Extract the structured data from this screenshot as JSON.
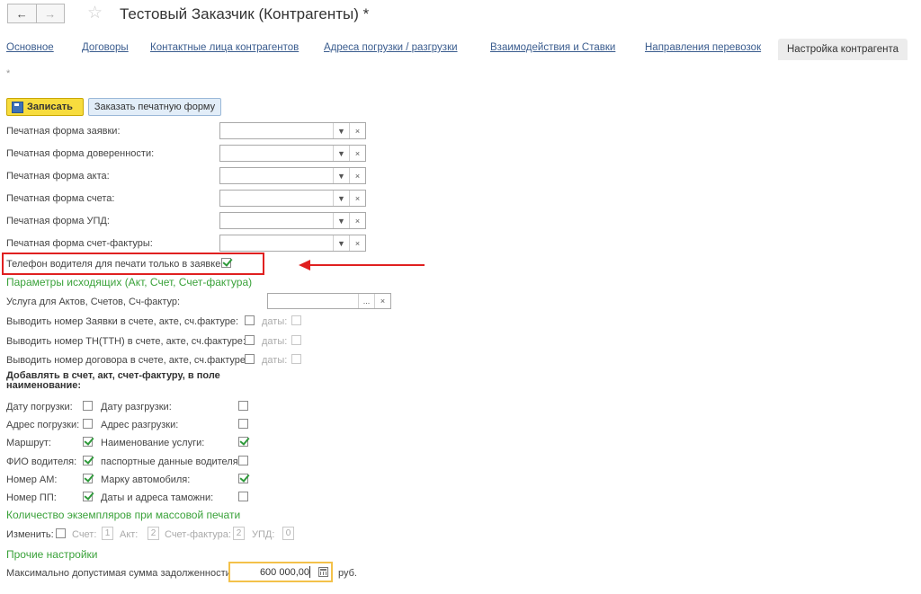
{
  "header": {
    "title": "Тестовый Заказчик (Контрагенты) *",
    "back_icon": "←",
    "fwd_icon": "→",
    "star_icon": "☆"
  },
  "tabs": [
    {
      "label": "Основное"
    },
    {
      "label": "Договоры"
    },
    {
      "label": "Контактные лица контрагентов"
    },
    {
      "label": "Адреса погрузки / разгрузки"
    },
    {
      "label": "Взаимодействия и Ставки"
    },
    {
      "label": "Направления перевозок"
    },
    {
      "label": "Настройка контрагента",
      "active": true
    }
  ],
  "modified_mark": "*",
  "toolbar": {
    "save_label": "Записать",
    "order_label": "Заказать печатную форму"
  },
  "print_forms": [
    {
      "label": "Печатная форма заявки:",
      "value": ""
    },
    {
      "label": "Печатная форма доверенности:",
      "value": ""
    },
    {
      "label": "Печатная форма акта:",
      "value": ""
    },
    {
      "label": "Печатная форма счета:",
      "value": ""
    },
    {
      "label": "Печатная форма УПД:",
      "value": ""
    },
    {
      "label": "Печатная форма счет-фактуры:",
      "value": ""
    }
  ],
  "driver_phone": {
    "label": "Телефон водителя для печати только в заявке:",
    "checked": true
  },
  "outgoing": {
    "title": "Параметры исходящих (Акт, Счет, Счет-фактура)",
    "service_label": "Услуга для Актов, Счетов, Сч-фактур:",
    "service_value": "",
    "dots": "...",
    "clear": "×",
    "rows": [
      {
        "label": "Выводить номер Заявки в счете, акте, сч.фактуре:",
        "checked": false,
        "date_label": "даты:",
        "date_checked": false
      },
      {
        "label": "Выводить номер ТН(ТТН) в счете, акте, сч.фактуре:",
        "checked": false,
        "date_label": "даты:",
        "date_checked": false
      },
      {
        "label": "Выводить номер договора в счете, акте, сч.фактуре:",
        "checked": false,
        "date_label": "даты:",
        "date_checked": false
      }
    ]
  },
  "add_to": {
    "title_line1": "Добавлять в счет, акт, счет-фактуру, в поле",
    "title_line2": "наименование:",
    "rows": [
      {
        "left": "Дату погрузки:",
        "left_checked": false,
        "right": "Дату разгрузки:",
        "right_checked": false
      },
      {
        "left": "Адрес погрузки:",
        "left_checked": false,
        "right": "Адрес разгрузки:",
        "right_checked": false
      },
      {
        "left": "Маршрут:",
        "left_checked": true,
        "right": "Наименование услуги:",
        "right_checked": true
      },
      {
        "left": "ФИО водителя:",
        "left_checked": true,
        "right": "паспортные данные водителя:",
        "right_checked": false
      },
      {
        "left": "Номер АМ:",
        "left_checked": true,
        "right": "Марку автомобиля:",
        "right_checked": true
      },
      {
        "left": "Номер ПП:",
        "left_checked": true,
        "right": "Даты и адреса таможни:",
        "right_checked": false
      }
    ]
  },
  "copies": {
    "title": "Количество экземпляров при массовой печати",
    "change_label": "Изменить:",
    "change_checked": false,
    "invoice_label": "Счет:",
    "invoice_value": "1",
    "act_label": "Акт:",
    "act_value": "2",
    "sf_label": "Счет-фактура:",
    "sf_value": "2",
    "upd_label": "УПД:",
    "upd_value": "0"
  },
  "other": {
    "title": "Прочие настройки",
    "debt_label": "Максимально допустимая сумма задолженности:",
    "debt_value": "600 000,00",
    "currency": "руб."
  },
  "colors": {
    "accent_green": "#3aa23a",
    "highlight_red": "#e02020",
    "save_yellow": "#f7dc3e",
    "link_blue": "#3a5c8e"
  }
}
